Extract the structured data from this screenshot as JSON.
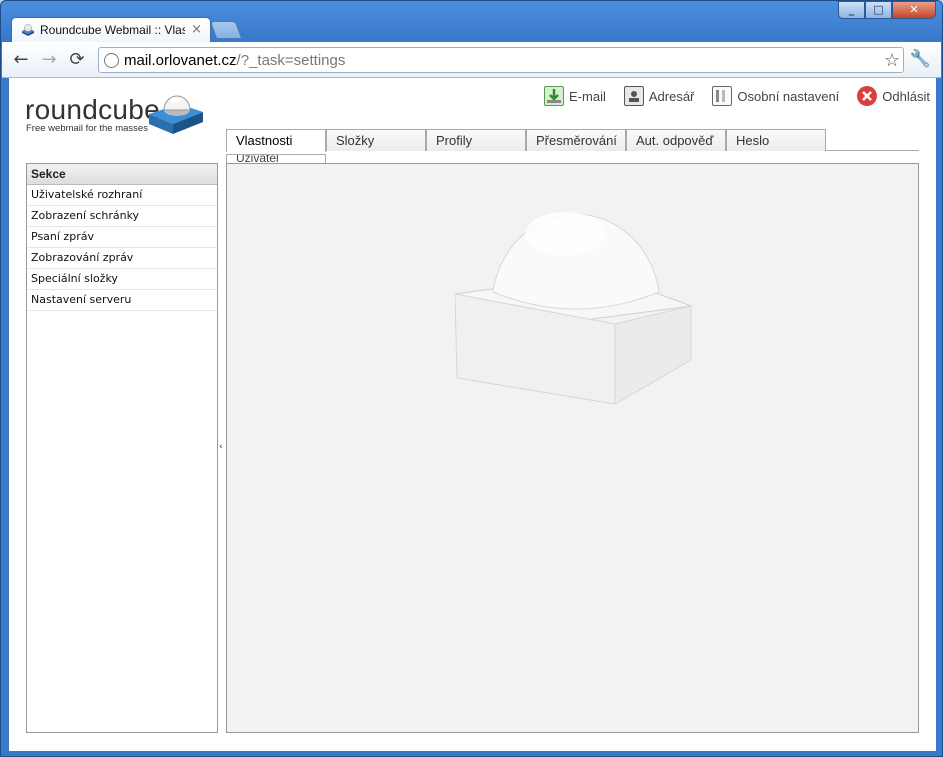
{
  "browser": {
    "tab_title": "Roundcube Webmail :: Vlastno",
    "tab_close": "×",
    "url_host": "mail.orlovanet.cz",
    "url_path": "/?_task=settings",
    "window_buttons": {
      "minimize": "_",
      "maximize": "□",
      "close": "✕"
    },
    "nav": {
      "back": "←",
      "forward": "→",
      "reload": "⟳"
    }
  },
  "logo": {
    "word": "roundcube",
    "tagline": "Free webmail for the masses"
  },
  "topnav": [
    {
      "label": "E-mail",
      "icon": "email-icon"
    },
    {
      "label": "Adresář",
      "icon": "addressbook-icon"
    },
    {
      "label": "Osobní nastavení",
      "icon": "settings-icon"
    },
    {
      "label": "Odhlásit",
      "icon": "logout-icon"
    }
  ],
  "tabs": [
    "Vlastnosti",
    "Složky",
    "Profily",
    "Přesměrování",
    "Aut. odpověď",
    "Heslo"
  ],
  "subtab": "Uživatel",
  "sidebar": {
    "heading": "Sekce",
    "items": [
      "Uživatelské rozhraní",
      "Zobrazení schránky",
      "Psaní zpráv",
      "Zobrazování zpráv",
      "Speciální složky",
      "Nastavení serveru"
    ]
  },
  "splitter": "‹",
  "colors": {
    "chrome": "#3a78c9",
    "content_bg": "#f2f2f2",
    "logo_blue": "#2d7fc3",
    "logout_red": "#d94040"
  }
}
